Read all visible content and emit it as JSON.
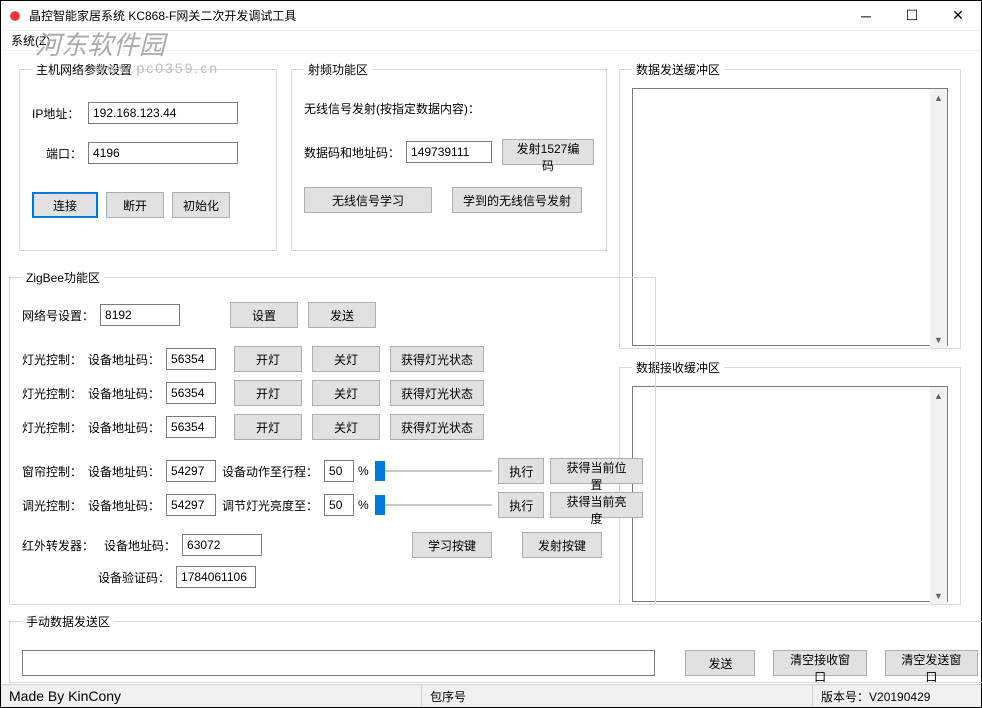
{
  "window": {
    "title": "晶控智能家居系统 KC868-F网关二次开发调试工具",
    "menu_system": "系统(Z)"
  },
  "watermark": {
    "name": "河东软件园",
    "url": "www.pc0359.cn"
  },
  "host": {
    "legend": "主机网络参数设置",
    "ip_label": "IP地址：",
    "ip": "192.168.123.44",
    "port_label": "端口：",
    "port": "4196",
    "connect": "连接",
    "disconnect": "断开",
    "init": "初始化"
  },
  "rf": {
    "legend": "射频功能区",
    "desc": "无线信号发射(按指定数据内容)：",
    "code_label": "数据码和地址码：",
    "code": "149739111",
    "send1527": "发射1527编码",
    "learn": "无线信号学习",
    "send_learned": "学到的无线信号发射"
  },
  "zigbee": {
    "legend": "ZigBee功能区",
    "net_label": "网络号设置：",
    "net": "8192",
    "set": "设置",
    "send": "发送",
    "light_label": "灯光控制：",
    "addr_label": "设备地址码：",
    "light_addr": "56354",
    "on": "开灯",
    "off": "关灯",
    "get_light": "获得灯光状态",
    "curtain_label": "窗帘控制：",
    "curtain_addr": "54297",
    "curtain_action_label": "设备动作至行程：",
    "curtain_pct": "50",
    "execute": "执行",
    "get_pos": "获得当前位置",
    "dimmer_label": "调光控制：",
    "dimmer_addr": "54297",
    "dimmer_action_label": "调节灯光亮度至：",
    "dimmer_pct": "50",
    "get_bright": "获得当前亮度",
    "ir_label": "红外转发器：",
    "ir_addr": "63072",
    "ir_verify_label": "设备验证码：",
    "ir_verify": "1784061106",
    "learn_key": "学习按键",
    "send_key": "发射按键",
    "pct": "%"
  },
  "sendbuf": {
    "legend": "数据发送缓冲区"
  },
  "recvbuf": {
    "legend": "数据接收缓冲区"
  },
  "manual": {
    "legend": "手动数据发送区",
    "send": "发送",
    "clear_recv": "清空接收窗口",
    "clear_send": "清空发送窗口"
  },
  "status": {
    "made_by": "Made By KinCony",
    "pkg_label": "包序号",
    "pkg": "",
    "ver_label": "版本号：",
    "ver": "V20190429"
  }
}
